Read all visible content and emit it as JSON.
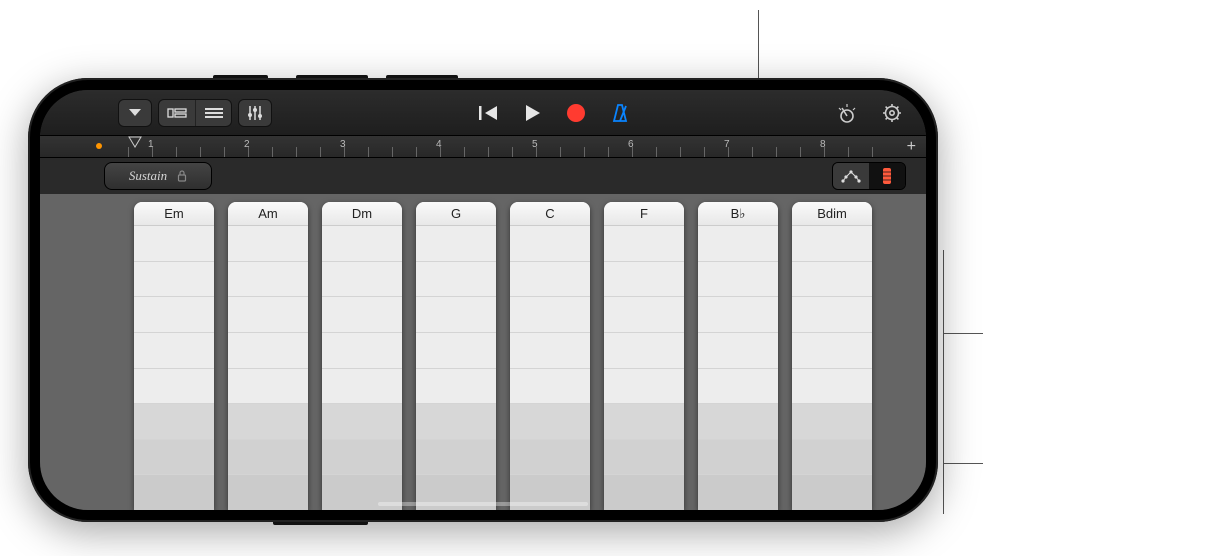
{
  "toolbar": {
    "rewind_icon": "rewind",
    "play_icon": "play",
    "record_icon": "record",
    "metronome_icon": "metronome",
    "tuner_icon": "tuner",
    "settings_icon": "settings"
  },
  "ruler": {
    "numbers": [
      "1",
      "2",
      "3",
      "4",
      "5",
      "6",
      "7",
      "8"
    ],
    "plus": "+"
  },
  "sustain": {
    "label": "Sustain"
  },
  "view_modes": {
    "mode_a_icon": "arpeggiator",
    "mode_b_icon": "chord-strips"
  },
  "chords": [
    "Em",
    "Am",
    "Dm",
    "G",
    "C",
    "F",
    "B♭",
    "Bdim"
  ]
}
